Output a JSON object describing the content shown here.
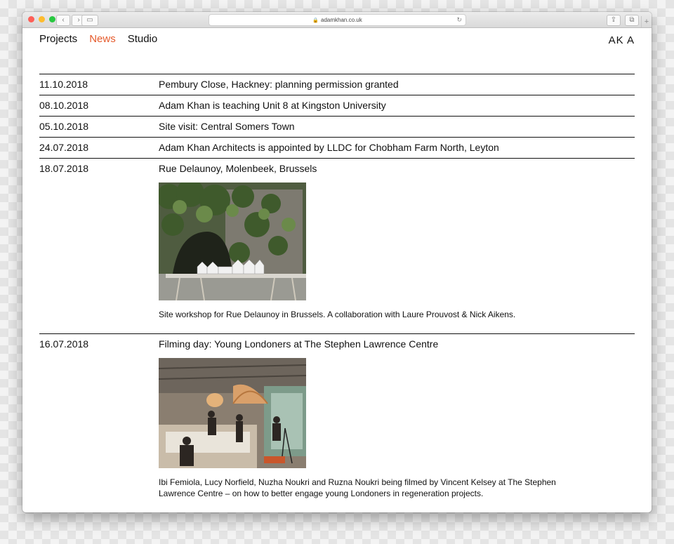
{
  "browser": {
    "url": "adamkhan.co.uk"
  },
  "nav": {
    "items": [
      {
        "label": "Projects",
        "active": false
      },
      {
        "label": "News",
        "active": true
      },
      {
        "label": "Studio",
        "active": false
      }
    ],
    "logo": "AK A"
  },
  "news": [
    {
      "date": "11.10.2018",
      "title": "Pembury Close, Hackney: planning permission granted"
    },
    {
      "date": "08.10.2018",
      "title": "Adam Khan is teaching Unit 8 at Kingston University"
    },
    {
      "date": "05.10.2018",
      "title": "Site visit: Central Somers Town"
    },
    {
      "date": "24.07.2018",
      "title": "Adam Khan Architects is appointed by LLDC for Chobham Farm North, Leyton"
    },
    {
      "date": "18.07.2018",
      "title": "Rue Delaunoy, Molenbeek, Brussels",
      "caption": "Site workshop for Rue Delaunoy in Brussels. A collaboration with Laure Prouvost & Nick Aikens."
    },
    {
      "date": "16.07.2018",
      "title": "Filming day: Young Londoners at The Stephen Lawrence Centre",
      "caption": "Ibi Femiola, Lucy Norfield, Nuzha Noukri and Ruzna Noukri being filmed by Vincent Kelsey at The Stephen Lawrence Centre – on how to better engage young Londoners in regeneration projects."
    }
  ],
  "colors": {
    "accent": "#e55a2b"
  }
}
